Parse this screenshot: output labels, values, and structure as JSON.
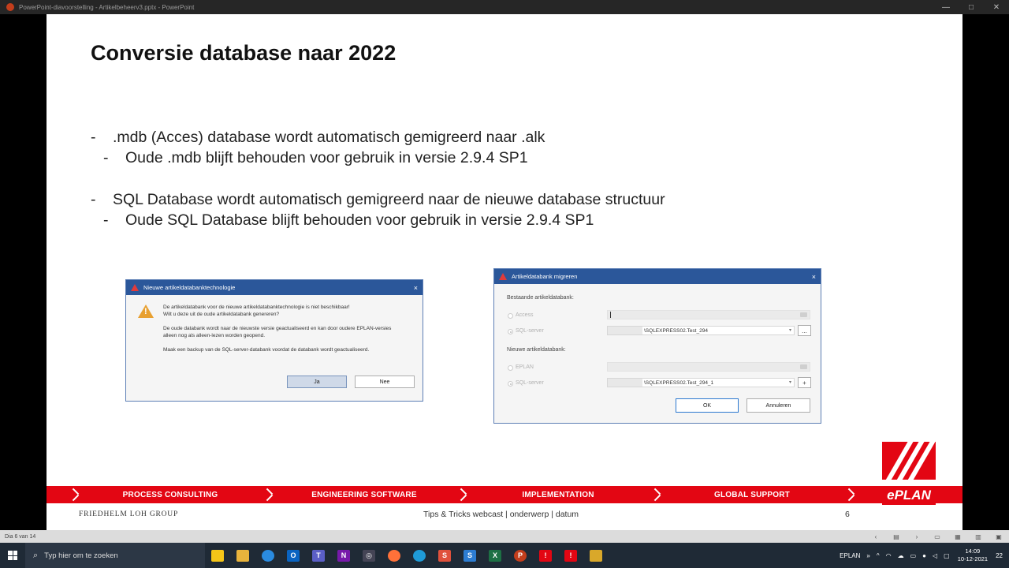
{
  "window": {
    "title": "PowerPoint-diavoorstelling  -  Artikelbeheerv3.pptx  -  PowerPoint",
    "minimize": "—",
    "maximize": "□",
    "close": "✕"
  },
  "slide": {
    "title": "Conversie database naar 2022",
    "bullets": [
      {
        "dash": "-",
        "text": ".mdb (Acces) database wordt automatisch gemigreerd naar .alk"
      },
      {
        "dash": "-",
        "text": "Oude .mdb blijft behouden voor gebruik in versie 2.9.4 SP1"
      },
      {
        "dash": "-",
        "text": "SQL Database wordt automatisch gemigreerd naar de nieuwe database structuur"
      },
      {
        "dash": "-",
        "text": "Oude SQL Database blijft behouden voor gebruik in versie 2.9.4 SP1"
      }
    ],
    "dialog1": {
      "title": "Nieuwe artikeldatabanktechnologie",
      "close": "×",
      "line1": "De artikeldatabank voor de nieuwe artikeldatabanktechnologie is niet beschikbaar!",
      "line2": "Wilt u deze uit de oude artikeldatabank genereren?",
      "line3": "De oude databank wordt naar de nieuwste versie geactualiseerd en kan door oudere EPLAN-versies",
      "line4": "alleen nog als alleen-lezen worden geopend.",
      "line5": "Maak een backup van de SQL-server-databank voordat de databank wordt geactualiseerd.",
      "yes": "Ja",
      "no": "Nee"
    },
    "dialog2": {
      "title": "Artikeldatabank migreren",
      "close": "×",
      "existing_label": "Bestaande artikeldatabank:",
      "access": "Access",
      "sql_server": "SQL-server",
      "existing_sql_value": "\\SQLEXPRESS02.Test_294",
      "browse": "...",
      "new_label": "Nieuwe artikeldatabank:",
      "eplan": "EPLAN",
      "sql_server2": "SQL-server",
      "new_sql_value": "\\SQLEXPRESS02.Test_294_1",
      "add": "+",
      "ok": "OK",
      "cancel": "Annuleren"
    },
    "band": [
      "PROCESS CONSULTING",
      "ENGINEERING SOFTWARE",
      "IMPLEMENTATION",
      "GLOBAL SUPPORT"
    ],
    "logo_word": "ePLAN",
    "footer_left": "FRIEDHELM LOH GROUP",
    "footer_center": "Tips & Tricks webcast | onderwerp | datum",
    "page_number": "6"
  },
  "statusbar": {
    "slide_info": "Dia 6 van 14"
  },
  "taskbar": {
    "search_placeholder": "Typ hier om te zoeken",
    "tray_label": "EPLAN",
    "time": "14:09",
    "date": "10-12-2021",
    "notification_count": "22"
  },
  "colors": {
    "eplan_red": "#e30613",
    "dialog_title": "#2b579a",
    "taskbar": "#1f2a36"
  }
}
